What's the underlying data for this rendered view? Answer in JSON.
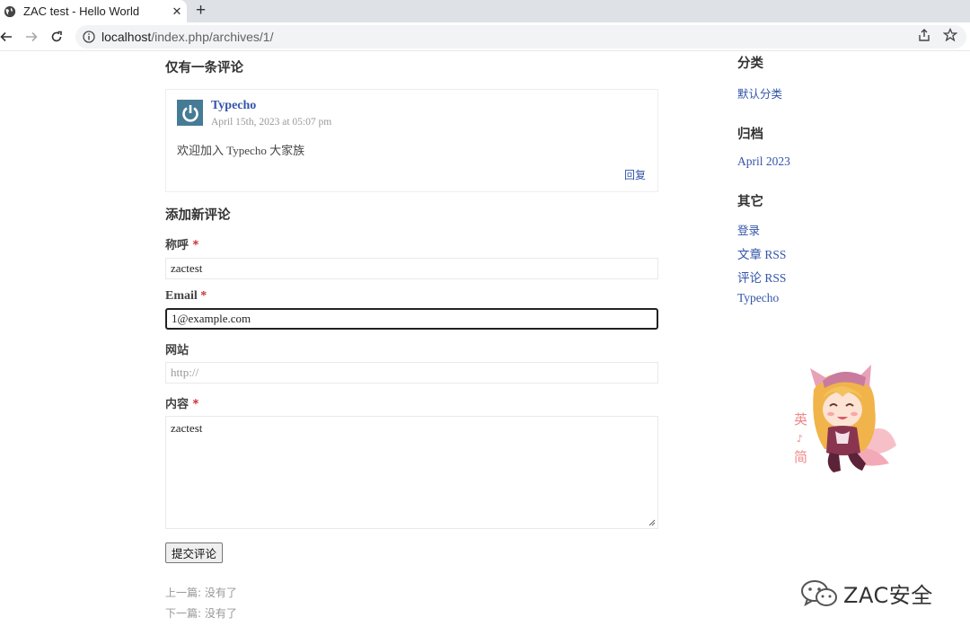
{
  "browser": {
    "tab_title": "ZAC test - Hello World",
    "tab_close": "✕",
    "new_tab": "+",
    "url_host": "localhost",
    "url_path": "/index.php/archives/1/"
  },
  "comments": {
    "title": "仅有一条评论",
    "items": [
      {
        "author": "Typecho",
        "date": "April 15th, 2023 at 05:07 pm",
        "text": "欢迎加入 Typecho 大家族",
        "reply_label": "回复"
      }
    ]
  },
  "respond": {
    "title": "添加新评论",
    "name_label": "称呼",
    "name_value": "zactest",
    "email_label": "Email",
    "email_value": "1@example.com",
    "url_label": "网站",
    "url_placeholder": "http://",
    "content_label": "内容",
    "content_value": "zactest",
    "required_mark": "*",
    "submit_label": "提交评论"
  },
  "post_nav": {
    "prev": "上一篇: 没有了",
    "next": "下一篇: 没有了"
  },
  "sidebar": {
    "categories_title": "分类",
    "categories": [
      "默认分类"
    ],
    "archives_title": "归档",
    "archives": [
      "April 2023"
    ],
    "other_title": "其它",
    "other_links": [
      "登录",
      "文章 RSS",
      "评论 RSS",
      "Typecho"
    ]
  },
  "mascot": {
    "vertical_text": [
      "英",
      "♪",
      "简"
    ]
  },
  "watermark": {
    "text": "ZAC安全"
  }
}
